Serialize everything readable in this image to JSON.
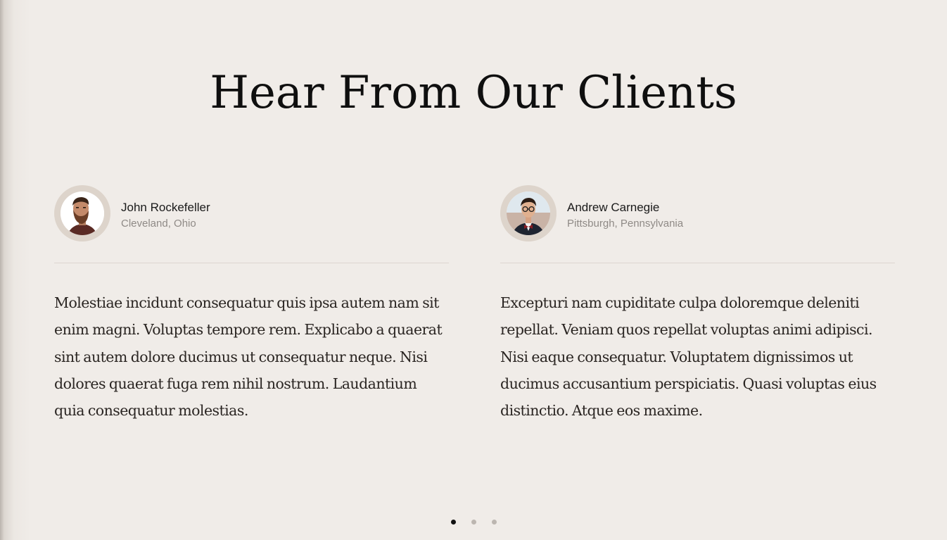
{
  "section": {
    "title": "Hear From Our Clients"
  },
  "testimonials": [
    {
      "name": "John Rockefeller",
      "location": "Cleveland, Ohio",
      "avatar_icon": "bearded-man-avatar",
      "quote": "Molestiae incidunt consequatur quis ipsa autem nam sit enim magni. Voluptas tempore rem. Explicabo a quaerat sint autem dolore ducimus ut consequatur neque. Nisi dolores quaerat fuga rem nihil nostrum. Laudantium quia consequatur molestias."
    },
    {
      "name": "Andrew Carnegie",
      "location": "Pittsburgh, Pennsylvania",
      "avatar_icon": "man-with-glasses-avatar",
      "quote": "Excepturi nam cupiditate culpa doloremque deleniti repellat. Veniam quos repellat voluptas animi adipisci. Nisi eaque consequatur. Voluptatem dignissimos ut ducimus accusantium perspiciatis. Quasi voluptas eius distinctio. Atque eos maxime."
    }
  ],
  "pagination": {
    "count": 3,
    "active_index": 0
  },
  "colors": {
    "background": "#f0ece8",
    "avatar_ring": "#ddd4cb",
    "dot_active": "#111111",
    "dot_inactive": "#bcb6b0"
  }
}
